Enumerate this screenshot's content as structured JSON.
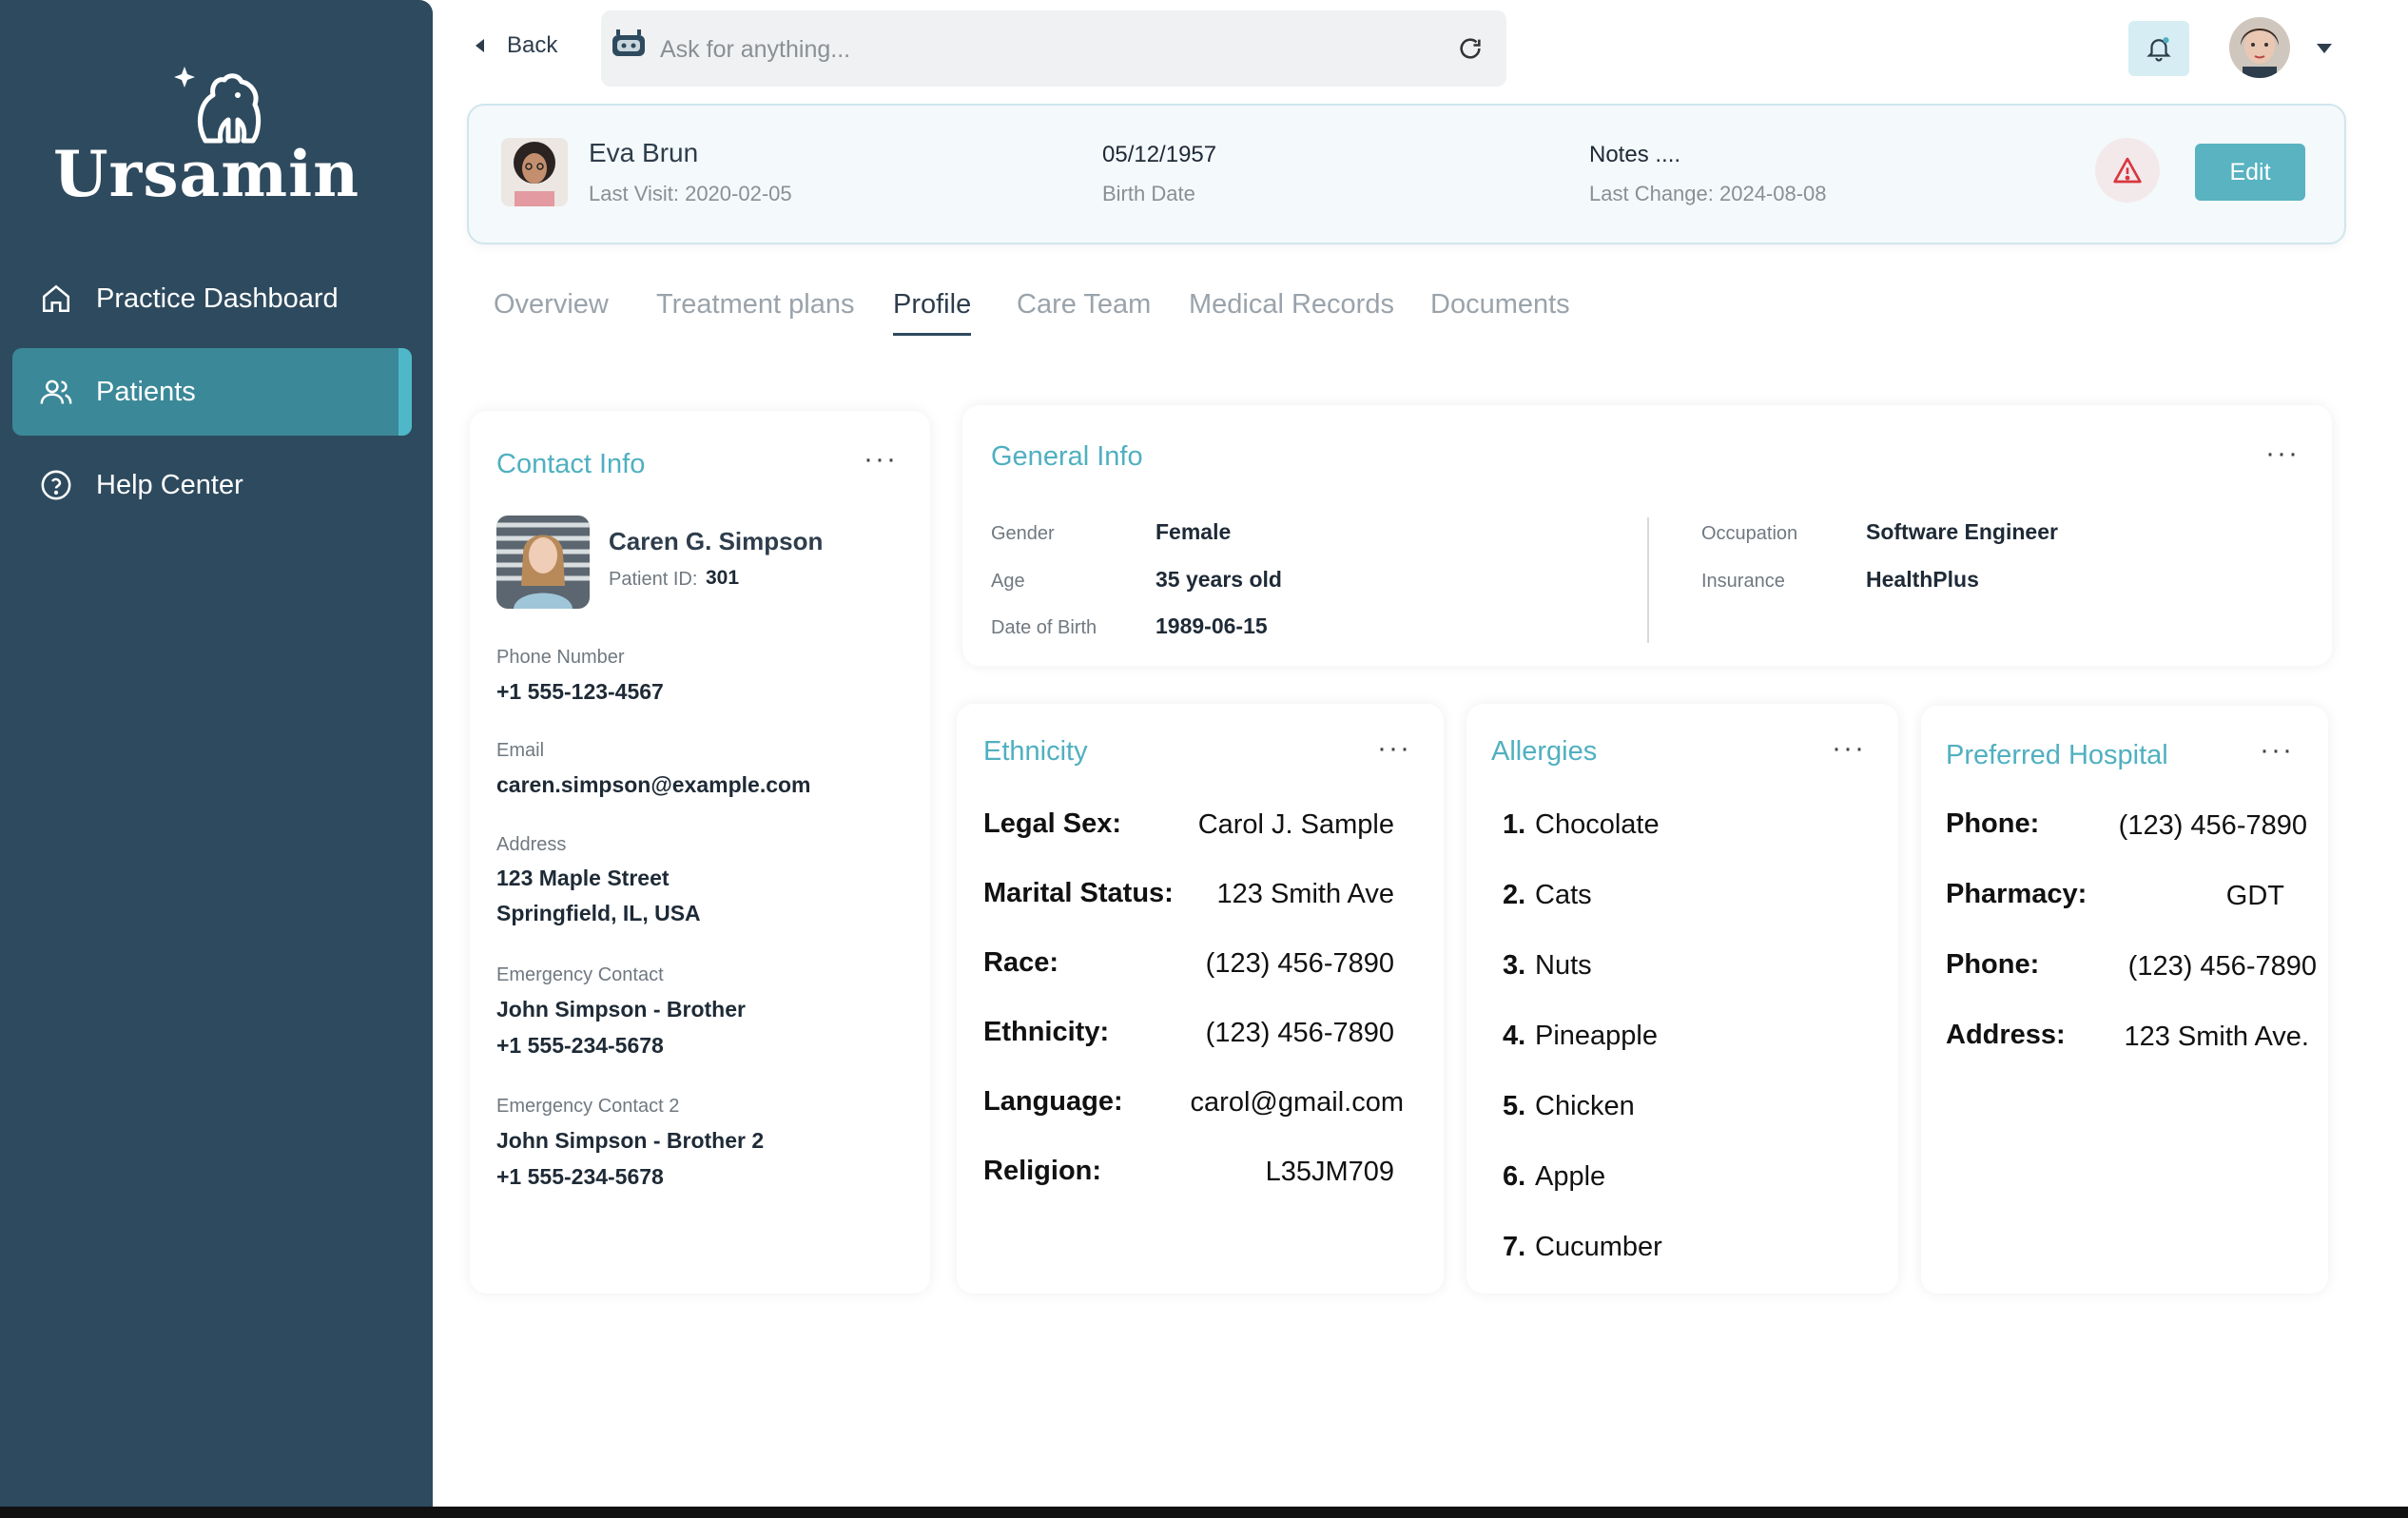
{
  "app": {
    "brand": "Ursamin"
  },
  "sidebar": {
    "items": [
      {
        "label": "Practice Dashboard",
        "icon": "home-icon"
      },
      {
        "label": "Patients",
        "icon": "users-icon",
        "active": true
      },
      {
        "label": "Help Center",
        "icon": "help-circle-icon"
      }
    ]
  },
  "topbar": {
    "back_label": "Back",
    "search_placeholder": "Ask for anything..."
  },
  "patient": {
    "name": "Eva Brun",
    "last_visit": "Last Visit: 2020-02-05",
    "birth_date": "05/12/1957",
    "birth_date_label": "Birth Date",
    "notes": "Notes ....",
    "last_change": "Last Change: 2024-08-08",
    "edit_label": "Edit"
  },
  "tabs": [
    {
      "label": "Overview"
    },
    {
      "label": "Treatment plans"
    },
    {
      "label": "Profile",
      "active": true
    },
    {
      "label": "Care Team"
    },
    {
      "label": "Medical Records"
    },
    {
      "label": "Documents"
    }
  ],
  "contact": {
    "title": "Contact Info",
    "name": "Caren G. Simpson",
    "patient_id_label": "Patient ID:",
    "patient_id": "301",
    "phone_label": "Phone Number",
    "phone": "+1 555-123-4567",
    "email_label": "Email",
    "email": "caren.simpson@example.com",
    "address_label": "Address",
    "address_line1": "123 Maple Street",
    "address_line2": "Springfield, IL, USA",
    "emergency_label": "Emergency Contact",
    "emergency_name": "John Simpson - Brother",
    "emergency_phone": "+1 555-234-5678",
    "emergency2_label": "Emergency Contact 2",
    "emergency2_name": "John Simpson - Brother 2",
    "emergency2_phone": "+1 555-234-5678"
  },
  "general": {
    "title": "General Info",
    "gender_label": "Gender",
    "gender": "Female",
    "age_label": "Age",
    "age": "35 years old",
    "dob_label": "Date of Birth",
    "dob": "1989-06-15",
    "occupation_label": "Occupation",
    "occupation": "Software Engineer",
    "insurance_label": "Insurance",
    "insurance": "HealthPlus"
  },
  "ethnicity": {
    "title": "Ethnicity",
    "rows": [
      {
        "label": "Legal Sex:",
        "value": "Carol J. Sample"
      },
      {
        "label": "Marital Status:",
        "value": "123 Smith Ave"
      },
      {
        "label": "Race:",
        "value": "(123) 456-7890"
      },
      {
        "label": "Ethnicity:",
        "value": "(123) 456-7890"
      },
      {
        "label": "Language:",
        "value": "carol@gmail.com"
      },
      {
        "label": "Religion:",
        "value": "L35JM709"
      }
    ]
  },
  "allergies": {
    "title": "Allergies",
    "items": [
      {
        "num": "1.",
        "name": "Chocolate"
      },
      {
        "num": "2.",
        "name": "Cats"
      },
      {
        "num": "3.",
        "name": "Nuts"
      },
      {
        "num": "4.",
        "name": "Pineapple"
      },
      {
        "num": "5.",
        "name": "Chicken"
      },
      {
        "num": "6.",
        "name": "Apple"
      },
      {
        "num": "7.",
        "name": "Cucumber"
      }
    ]
  },
  "hospital": {
    "title": "Preferred Hospital",
    "rows": [
      {
        "label": "Phone:",
        "value": "(123) 456-7890"
      },
      {
        "label": "Pharmacy:",
        "value": "GDT"
      },
      {
        "label": "Phone:",
        "value": "(123) 456-7890"
      },
      {
        "label": "Address:",
        "value": "123 Smith Ave."
      }
    ]
  },
  "colors": {
    "sidebar": "#2e4a5e",
    "accent": "#4fb0c0",
    "active_nav": "#3b8898",
    "edit_button": "#59b3c1",
    "warning": "#d9363e"
  }
}
